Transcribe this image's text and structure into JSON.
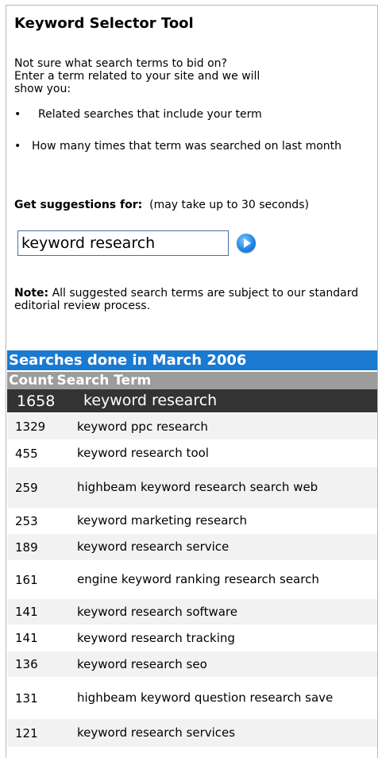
{
  "title": "Keyword Selector Tool",
  "intro": {
    "line1": "Not sure what search terms to bid on?",
    "line2": "Enter a term related to your site and we will",
    "line3": "show you:"
  },
  "bullets": [
    {
      "symbol": "•",
      "text": "Related searches that include your term"
    },
    {
      "symbol": "•",
      "text": "How many times that term was searched on last month"
    }
  ],
  "suggest": {
    "label": "Get suggestions for:",
    "note": "(may take up to 30 seconds)",
    "input_value": "keyword research",
    "go_icon": "blue-circle-arrow-icon"
  },
  "note": {
    "label": "Note:",
    "text": "All suggested search terms are subject to our standard editorial review process."
  },
  "results": {
    "header": "Searches done in March 2006",
    "columns": {
      "count": "Count",
      "term": "Search Term"
    },
    "rows": [
      {
        "count": "1658",
        "term": "keyword research"
      },
      {
        "count": "1329",
        "term": "keyword ppc research"
      },
      {
        "count": "455",
        "term": "keyword research tool"
      },
      {
        "count": "259",
        "term": "highbeam keyword research search web"
      },
      {
        "count": "253",
        "term": "keyword marketing research"
      },
      {
        "count": "189",
        "term": "keyword research service"
      },
      {
        "count": "161",
        "term": "engine keyword ranking research search"
      },
      {
        "count": "141",
        "term": "keyword research software"
      },
      {
        "count": "141",
        "term": "keyword research tracking"
      },
      {
        "count": "136",
        "term": "keyword research seo"
      },
      {
        "count": "131",
        "term": "highbeam keyword question research save"
      },
      {
        "count": "121",
        "term": "keyword research services"
      }
    ]
  },
  "colors": {
    "header_blue": "#1a79d0",
    "column_header_gray": "#9c9c9c",
    "top_row_dark": "#333333"
  }
}
